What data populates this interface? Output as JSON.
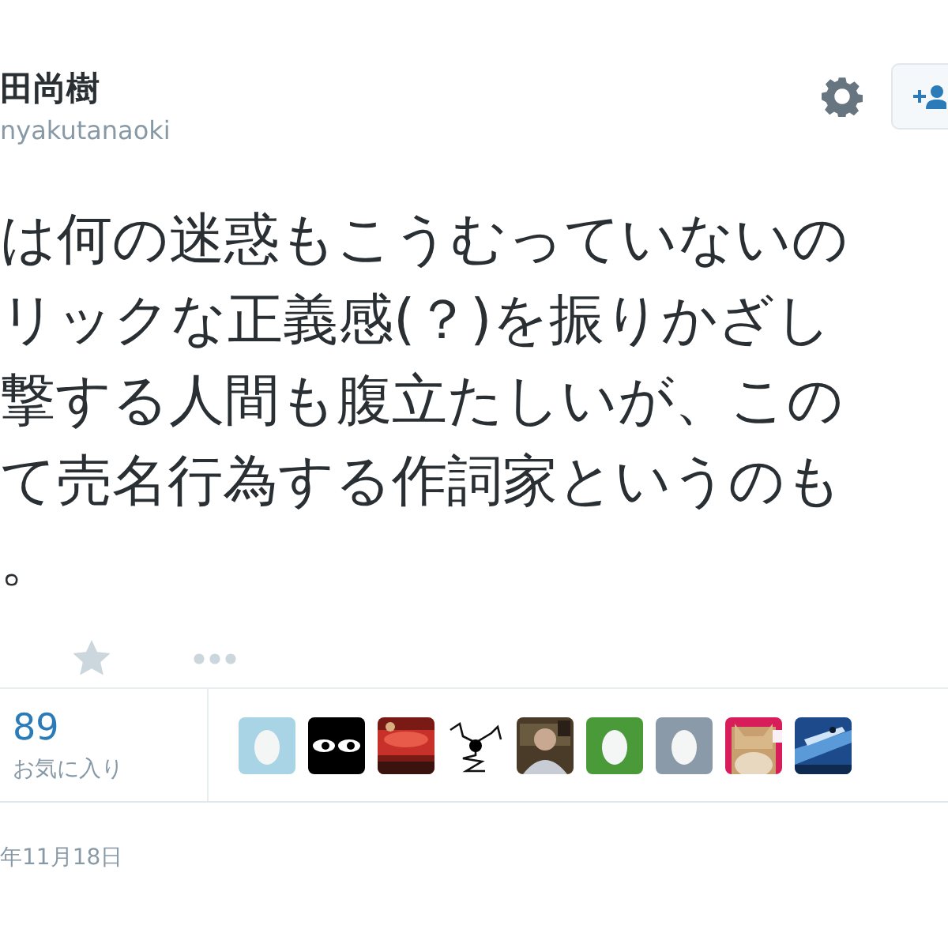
{
  "author": {
    "name": "田尚樹",
    "handle": "nyakutanaoki"
  },
  "tweet": {
    "lines": [
      "は何の迷惑もこうむっていないの",
      "リックな正義感(？)を振りかざし",
      "撃する人間も腹立たしいが、この",
      "て売名行為する作詞家というのも",
      "。"
    ]
  },
  "favorites": {
    "count": "89",
    "label": "お気に入り",
    "avatars": [
      {
        "kind": "egg",
        "color": "#a8d4e6"
      },
      {
        "kind": "eyes"
      },
      {
        "kind": "picture"
      },
      {
        "kind": "sketch"
      },
      {
        "kind": "picture"
      },
      {
        "kind": "egg",
        "color": "#4a9a3a"
      },
      {
        "kind": "egg",
        "color": "#8a9aa8"
      },
      {
        "kind": "picture"
      },
      {
        "kind": "picture"
      }
    ]
  },
  "date": "年11月18日"
}
